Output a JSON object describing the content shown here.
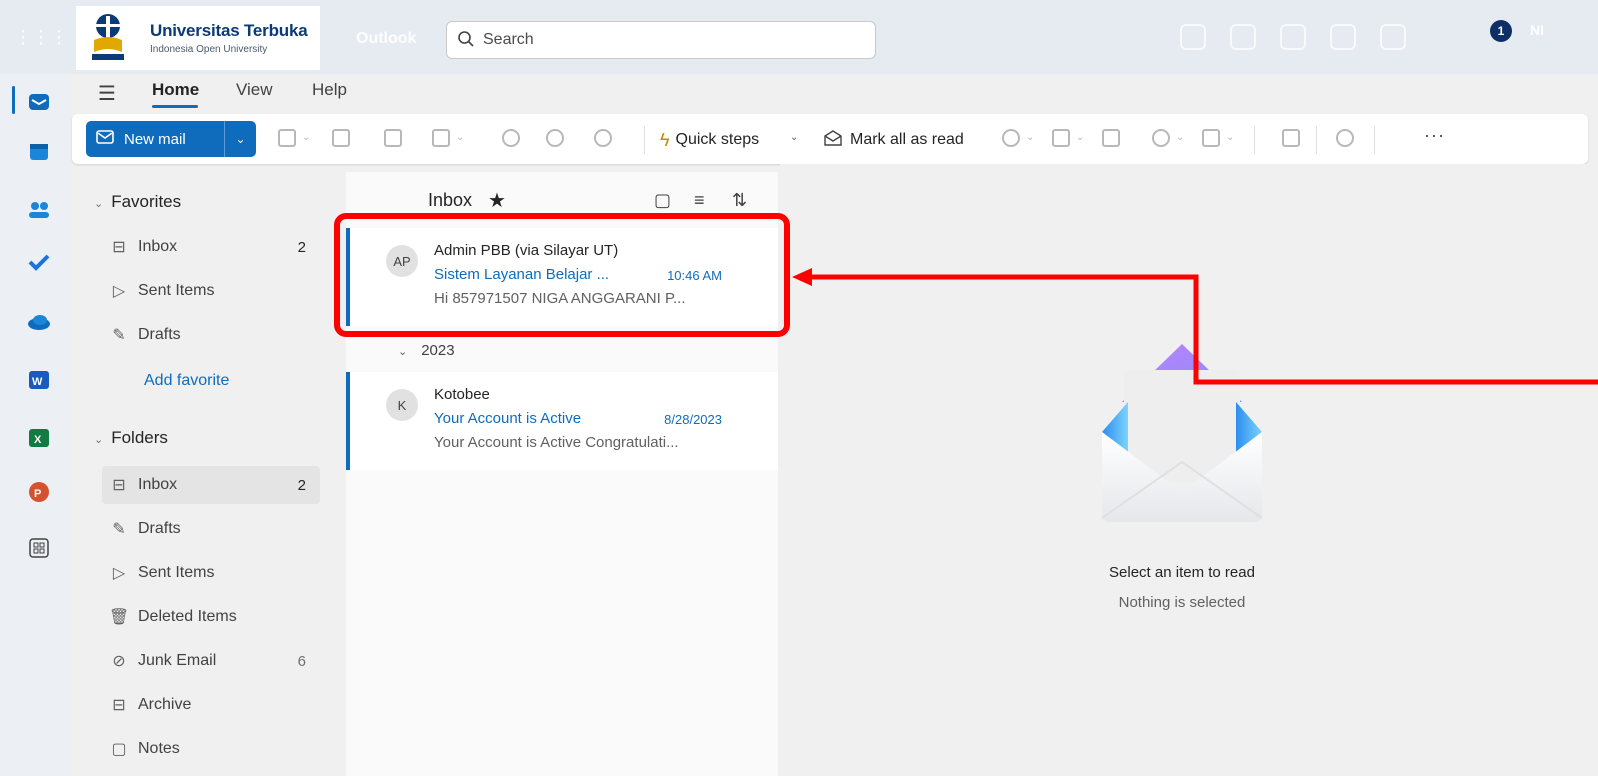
{
  "header": {
    "brand_name": "Universitas Terbuka",
    "brand_sub": "Indonesia Open University",
    "app_name": "Outlook",
    "search_placeholder": "Search",
    "notification_count": "1",
    "user_initials": "NI"
  },
  "nav_tabs": [
    {
      "label": "Home"
    },
    {
      "label": "View"
    },
    {
      "label": "Help"
    }
  ],
  "ribbon": {
    "new_mail_label": "New mail",
    "quick_steps_label": "Quick steps",
    "mark_all_read_label": "Mark all as read",
    "more_label": "···"
  },
  "folders": {
    "favorites_title": "Favorites",
    "favorites": [
      {
        "label": "Inbox",
        "count": "2"
      },
      {
        "label": "Sent Items",
        "count": ""
      },
      {
        "label": "Drafts",
        "count": ""
      }
    ],
    "add_favorite_label": "Add favorite",
    "folders_title": "Folders",
    "items": [
      {
        "label": "Inbox",
        "count": "2"
      },
      {
        "label": "Drafts",
        "count": ""
      },
      {
        "label": "Sent Items",
        "count": ""
      },
      {
        "label": "Deleted Items",
        "count": ""
      },
      {
        "label": "Junk Email",
        "count": "6"
      },
      {
        "label": "Archive",
        "count": ""
      },
      {
        "label": "Notes",
        "count": ""
      }
    ]
  },
  "message_list": {
    "title": "Inbox",
    "group_label": "2023",
    "messages": [
      {
        "initials": "AP",
        "from": "Admin PBB (via Silayar UT)",
        "subject": "Sistem Layanan Belajar ...",
        "time": "10:46 AM",
        "preview": "Hi 857971507 NIGA ANGGARANI P..."
      },
      {
        "initials": "K",
        "from": "Kotobee",
        "subject": "Your Account is Active",
        "time": "8/28/2023",
        "preview": "Your Account is Active Congratulati..."
      }
    ]
  },
  "reading_pane": {
    "title": "Select an item to read",
    "subtitle": "Nothing is selected"
  },
  "colors": {
    "accent": "#0f6cbd",
    "annotation": "#ff0000",
    "header_bg": "#e6ebf2"
  }
}
